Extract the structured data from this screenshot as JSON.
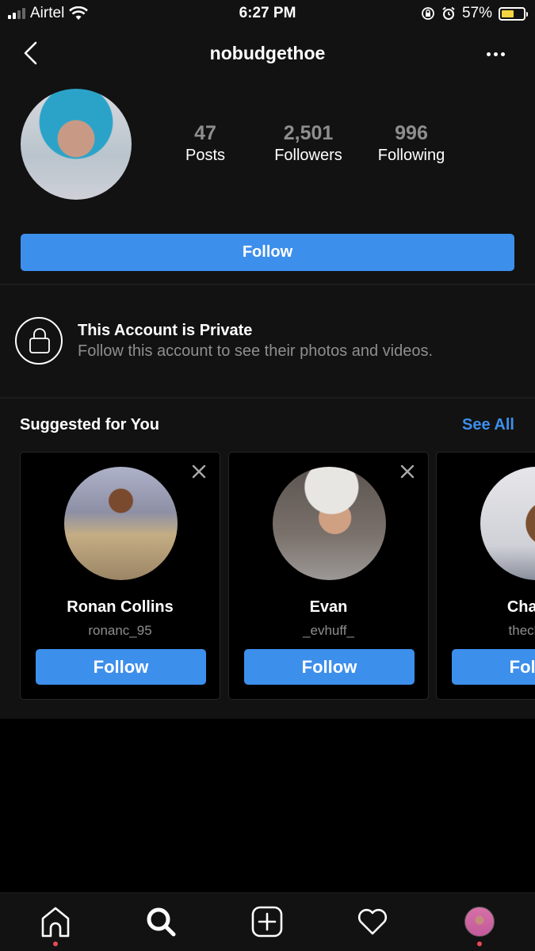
{
  "status_bar": {
    "carrier": "Airtel",
    "time": "6:27 PM",
    "battery_percent": "57%",
    "battery_level": 0.57,
    "icons": [
      "signal-icon",
      "wifi-icon",
      "orientation-lock-icon",
      "alarm-icon",
      "battery-icon"
    ]
  },
  "header": {
    "username": "nobudgethoe",
    "back_icon": "chevron-left-icon",
    "more_icon": "more-horizontal-icon"
  },
  "profile": {
    "stats": [
      {
        "value": "47",
        "label": "Posts"
      },
      {
        "value": "2,501",
        "label": "Followers"
      },
      {
        "value": "996",
        "label": "Following"
      }
    ],
    "follow_label": "Follow"
  },
  "private_notice": {
    "icon": "lock-icon",
    "title": "This Account is Private",
    "subtitle": "Follow this account to see their photos and videos."
  },
  "suggested": {
    "title": "Suggested for You",
    "see_all": "See All",
    "cards": [
      {
        "name": "Ronan Collins",
        "handle": "ronanc_95",
        "button": "Follow"
      },
      {
        "name": "Evan",
        "handle": "_evhuff_",
        "button": "Follow"
      },
      {
        "name": "Charles",
        "handle": "thecharle",
        "button": "Follow"
      }
    ]
  },
  "tab_bar": {
    "tabs": [
      {
        "name": "home",
        "icon": "home-icon",
        "has_notification": true
      },
      {
        "name": "search",
        "icon": "search-icon",
        "active": true
      },
      {
        "name": "new-post",
        "icon": "plus-square-icon"
      },
      {
        "name": "activity",
        "icon": "heart-icon"
      },
      {
        "name": "profile",
        "icon": "profile-avatar",
        "has_notification": true
      }
    ]
  },
  "colors": {
    "accent": "#3d8fec",
    "background": "#121212",
    "secondary_text": "#8e8e8e",
    "notification_dot": "#ed4956",
    "battery_fill": "#f5d341"
  }
}
